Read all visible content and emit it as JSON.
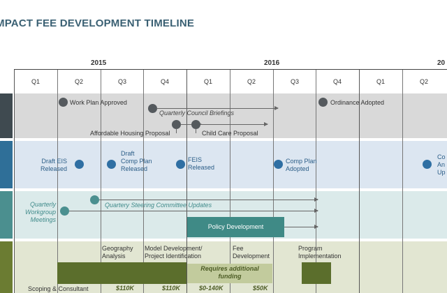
{
  "title": "MPACT FEE DEVELOPMENT TIMELINE",
  "years": [
    "2015",
    "2016",
    "20"
  ],
  "quarters": [
    "Q1",
    "Q2",
    "Q3",
    "Q4",
    "Q1",
    "Q2",
    "Q3",
    "Q4",
    "Q1",
    "Q2"
  ],
  "band1": {
    "work_plan": "Work Plan Approved",
    "ordinance": "Ordinance Adopted",
    "briefings": "Quarterly Council Briefings",
    "affordable": "Affordable Housing Proposal",
    "child_care": "Child Care Proposal"
  },
  "band2": {
    "draft_eis": [
      "Draft EIS",
      "Released"
    ],
    "draft_comp": [
      "Draft",
      "Comp Plan",
      "Released"
    ],
    "feis": [
      "FEIS",
      "Released"
    ],
    "comp_adopted": [
      "Comp Plan",
      "Adopted"
    ],
    "cut_off": [
      "Co",
      "An",
      "Up"
    ]
  },
  "band3": {
    "workgroup": [
      "Quarterly",
      "Workgroup",
      "Meetings"
    ],
    "steering": "Quartery Steering Committee Updates",
    "policy": "Policy Development"
  },
  "band4": {
    "geography": [
      "Geography",
      "Analysis"
    ],
    "model": [
      "Model Development/",
      "Project Identification"
    ],
    "fee": [
      "Fee",
      "Development"
    ],
    "program": [
      "Program",
      "Implementation"
    ],
    "funding": [
      "Requires additional",
      "funding"
    ],
    "scoping": "Scoping & Consultant",
    "costs": [
      "$110K",
      "$110K",
      "$0-140K",
      "$50K"
    ]
  },
  "colors": {
    "band1": "#d9d9d9",
    "band2": "#dce6f1",
    "band3": "#dbeaea",
    "band4": "#e2e6d2",
    "tab1": "#3f4a50",
    "tab2": "#2f6f98",
    "tab3": "#4b8f8f",
    "tab4": "#6b7c32",
    "dot1": "#555a5e",
    "dot2": "#2f6fa3",
    "dot3": "#4b9090"
  }
}
